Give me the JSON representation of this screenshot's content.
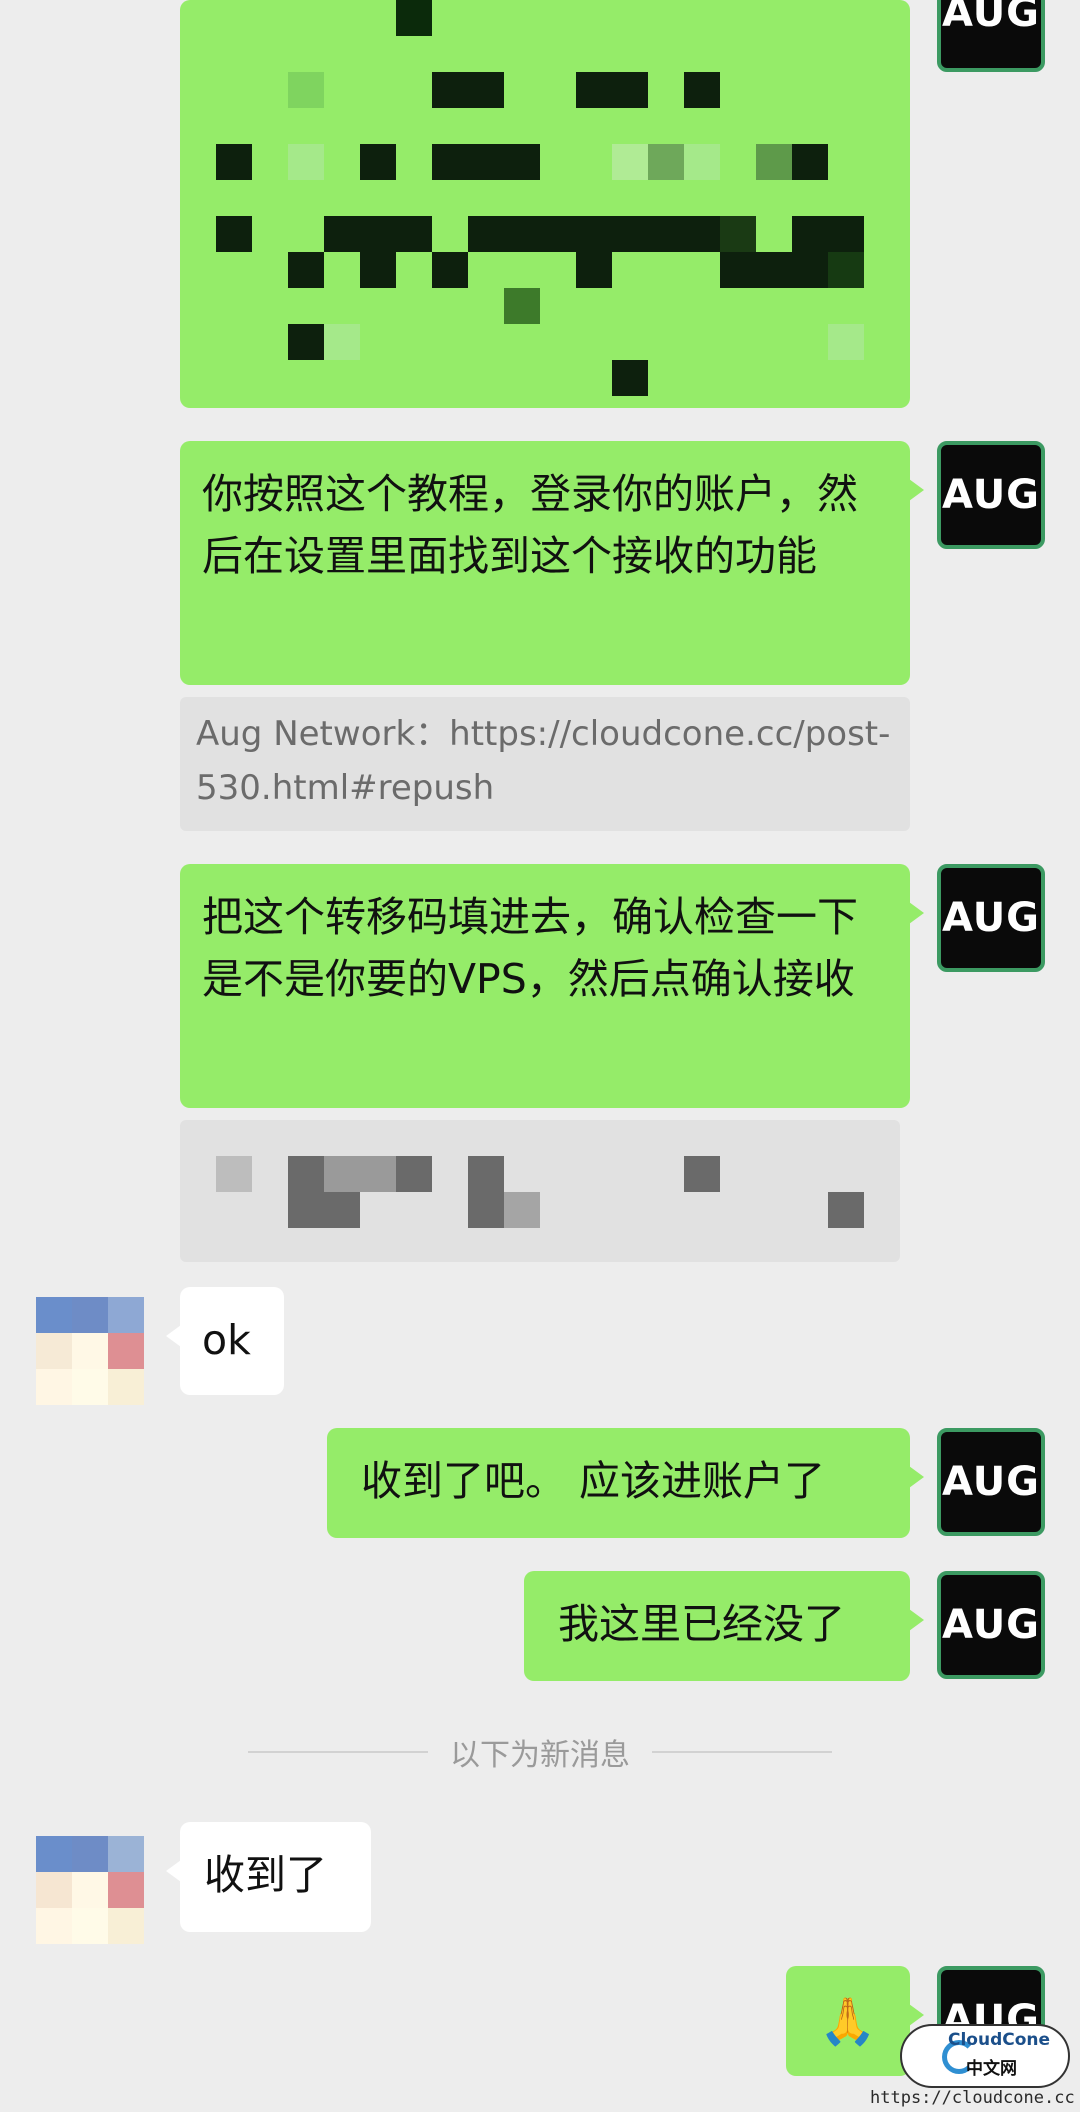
{
  "accent_green": "#95ec69",
  "background": "#ededed",
  "self_avatar": {
    "label": "AUG"
  },
  "messages": [
    {
      "id": "m1",
      "from": "self",
      "type": "image",
      "redacted": true
    },
    {
      "id": "m2",
      "from": "self",
      "type": "text",
      "text": "你按照这个教程，登录你的账户，然后在设置里面找到这个接收的功能"
    },
    {
      "id": "m2q",
      "type": "quote",
      "text": "Aug Network：https://cloudcone.cc/post-530.html#repush"
    },
    {
      "id": "m3",
      "from": "self",
      "type": "text",
      "text": "把这个转移码填进去，确认检查一下是不是你要的VPS，然后点确认接收"
    },
    {
      "id": "m3q",
      "type": "quote",
      "redacted": true
    },
    {
      "id": "m4",
      "from": "peer",
      "type": "text",
      "text": "ok"
    },
    {
      "id": "m5",
      "from": "self",
      "type": "text",
      "text": "收到了吧。 应该进账户了"
    },
    {
      "id": "m6",
      "from": "self",
      "type": "text",
      "text": "我这里已经没了"
    },
    {
      "id": "m7",
      "from": "peer",
      "type": "text",
      "text": "收到了"
    },
    {
      "id": "m8",
      "from": "self",
      "type": "emoji",
      "text": "🙏"
    }
  ],
  "divider": {
    "label": "以下为新消息"
  },
  "watermark": {
    "brand": "CloudCone",
    "subtitle": "中文网",
    "url": "https://cloudcone.cc"
  },
  "icons": {
    "self_avatar": "aug-logo-avatar",
    "peer_avatar": "pixelated-avatar",
    "emoji": "folded-hands-emoji"
  }
}
